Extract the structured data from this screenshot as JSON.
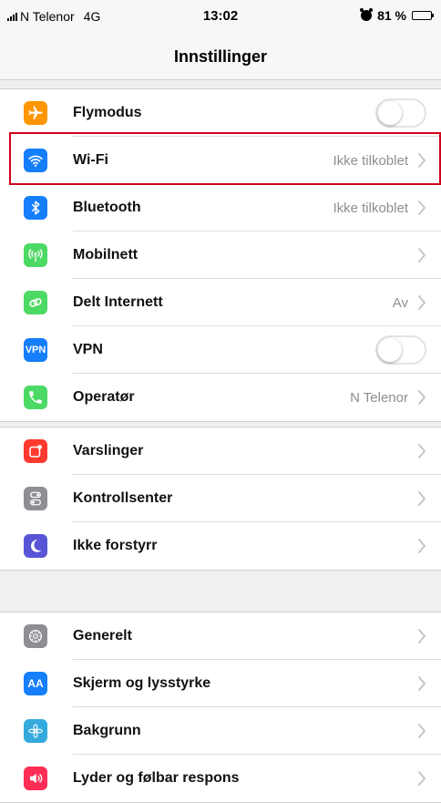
{
  "status_bar": {
    "carrier": "N Telenor",
    "network": "4G",
    "time": "13:02",
    "battery": "81 %",
    "battery_level": 0.81
  },
  "nav": {
    "title": "Innstillinger"
  },
  "groups": [
    {
      "rows": [
        {
          "label": "Flymodus",
          "icon": "airplane-icon",
          "color": "#ff9500",
          "control": "toggle",
          "toggle_on": false
        },
        {
          "label": "Wi-Fi",
          "icon": "wifi-icon",
          "color": "#147efb",
          "value": "Ikke tilkoblet",
          "control": "chevron",
          "highlighted": true
        },
        {
          "label": "Bluetooth",
          "icon": "bluetooth-icon",
          "color": "#147efb",
          "value": "Ikke tilkoblet",
          "control": "chevron"
        },
        {
          "label": "Mobilnett",
          "icon": "antenna-icon",
          "color": "#4cd964",
          "control": "chevron"
        },
        {
          "label": "Delt Internett",
          "icon": "chain-icon",
          "color": "#4cd964",
          "value": "Av",
          "control": "chevron"
        },
        {
          "label": "VPN",
          "icon": "vpn-icon",
          "color": "#147efb",
          "icon_text": "VPN",
          "control": "toggle",
          "toggle_on": false
        },
        {
          "label": "Operatør",
          "icon": "phone-icon",
          "color": "#4cd964",
          "value": "N Telenor",
          "control": "chevron"
        }
      ]
    },
    {
      "rows": [
        {
          "label": "Varslinger",
          "icon": "notifications-icon",
          "color": "#ff3b30",
          "control": "chevron"
        },
        {
          "label": "Kontrollsenter",
          "icon": "control-center-icon",
          "color": "#8e8e93",
          "control": "chevron"
        },
        {
          "label": "Ikke forstyrr",
          "icon": "moon-icon",
          "color": "#5856d6",
          "control": "chevron"
        }
      ]
    },
    {
      "rows": [
        {
          "label": "Generelt",
          "icon": "gear-icon",
          "color": "#8e8e93",
          "control": "chevron"
        },
        {
          "label": "Skjerm og lysstyrke",
          "icon": "display-icon",
          "color": "#147efb",
          "icon_text": "AA",
          "control": "chevron"
        },
        {
          "label": "Bakgrunn",
          "icon": "wallpaper-icon",
          "color": "#34aadc",
          "control": "chevron"
        },
        {
          "label": "Lyder og følbar respons",
          "icon": "speaker-icon",
          "color": "#ff2d55",
          "control": "chevron"
        }
      ]
    }
  ]
}
